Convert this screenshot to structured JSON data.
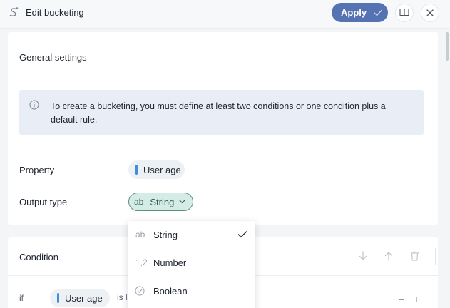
{
  "header": {
    "title": "Edit bucketing",
    "apply_label": "Apply",
    "icons": [
      "script-s-icon",
      "check-icon",
      "book-icon",
      "close-icon"
    ]
  },
  "general": {
    "title": "General settings",
    "info_text": "To create a bucketing, you must define at least two conditions or one condition plus a default rule.",
    "property_label": "Property",
    "property_value": "User age",
    "output_type_label": "Output type",
    "output_type_code": "ab",
    "output_type_value": "String"
  },
  "condition": {
    "title": "Condition",
    "if_label": "if",
    "property_value": "User age",
    "operator_partial": "is l",
    "minus_label": "–",
    "plus_label": "+",
    "icons": [
      "arrow-down-icon",
      "arrow-up-icon",
      "trash-icon"
    ]
  },
  "dropdown": {
    "options": [
      {
        "code": "ab",
        "label": "String",
        "selected": true
      },
      {
        "code": "1,2",
        "label": "Number",
        "selected": false
      },
      {
        "code": "",
        "label": "Boolean",
        "selected": false
      }
    ]
  },
  "colors": {
    "accent": "#5572b2",
    "info_bg": "#e8edf6",
    "selected_type_bg": "#d5ebe6",
    "property_bar": "#3d8fdc"
  }
}
